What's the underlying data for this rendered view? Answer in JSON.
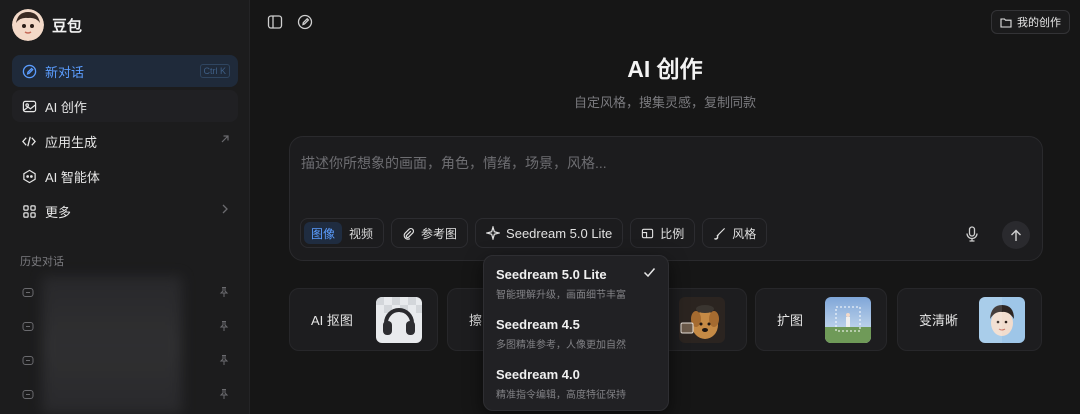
{
  "brand": {
    "name": "豆包"
  },
  "nav": {
    "items": [
      {
        "label": "新对话",
        "shortcut": "Ctrl K"
      },
      {
        "label": "AI 创作"
      },
      {
        "label": "应用生成"
      },
      {
        "label": "AI 智能体"
      },
      {
        "label": "更多"
      }
    ]
  },
  "history": {
    "title": "历史对话"
  },
  "toolbar": {
    "my_creations": "我的创作"
  },
  "main": {
    "title": "AI 创作",
    "subtitle": "自定风格，搜集灵感，复制同款"
  },
  "composer": {
    "placeholder": "描述你所想象的画面，角色，情绪，场景，风格...",
    "mode_image": "图像",
    "mode_video": "视频",
    "reference": "参考图",
    "model": "Seedream 5.0 Lite",
    "ratio": "比例",
    "style": "风格"
  },
  "cards": [
    {
      "label": "AI 抠图"
    },
    {
      "label": "擦"
    },
    {
      "label": ""
    },
    {
      "label": "扩图"
    },
    {
      "label": "变清晰"
    }
  ],
  "model_menu": {
    "options": [
      {
        "name": "Seedream 5.0 Lite",
        "desc": "智能理解升级，画面细节丰富",
        "selected": true
      },
      {
        "name": "Seedream 4.5",
        "desc": "多图精准参考，人像更加自然",
        "selected": false
      },
      {
        "name": "Seedream 4.0",
        "desc": "精准指令编辑，高度特征保持",
        "selected": false
      }
    ]
  },
  "colors": {
    "accent": "#5b9dff",
    "background": "#161616",
    "sidebar": "#1c1c1d"
  }
}
